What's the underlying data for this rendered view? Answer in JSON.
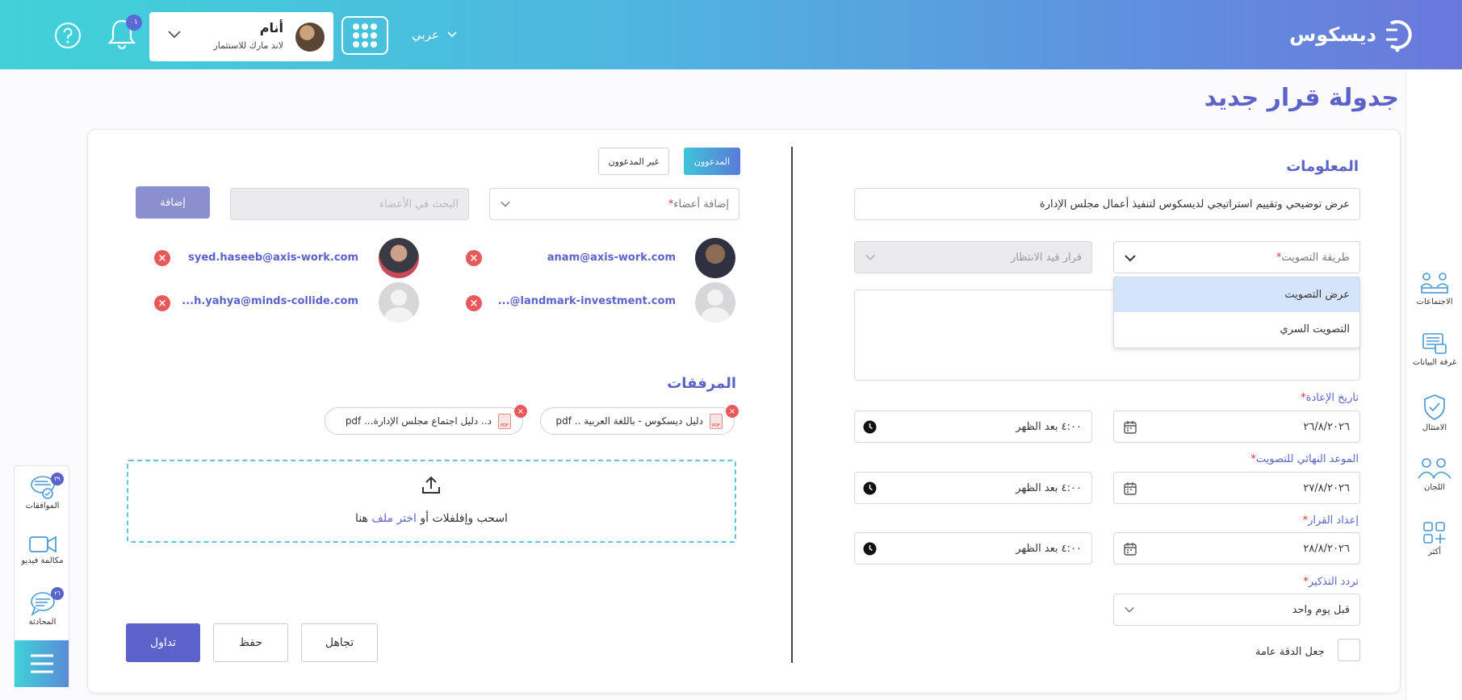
{
  "header": {
    "brand": "ديسكوس",
    "language": "عربي",
    "user_name": "أنام",
    "user_company": "لاند مارك للاستثمار",
    "notification_count": "٠١"
  },
  "page": {
    "title": "جدولة قرار جديد"
  },
  "info": {
    "section_title": "المعلومات",
    "subject_value": "عرض توضيحي وتقييم استراتيجي لديسكوس لتنفيذ أعمال مجلس الإدارة",
    "vote_method_placeholder": "طريقة التصويت",
    "status_value": "قرار قيد الانتظار",
    "vote_method_options": [
      "عرض التصويت",
      "التصويت السري"
    ],
    "reminder_date_label": "تاريخ الإعادة",
    "reminder_date": "٢٦/٨/٢٠٢٦",
    "reminder_time": "٤:٠٠ بعد الظهر",
    "deadline_label": "الموعد النهائي للتصويت",
    "deadline_date": "٢٧/٨/٢٠٢٦",
    "deadline_time": "٤:٠٠ بعد الظهر",
    "prep_label": "إعداد القرار",
    "prep_date": "٢٨/٨/٢٠٢٦",
    "prep_time": "٤:٠٠ بعد الظهر",
    "frequency_label": "تردد التذكير",
    "frequency_value": "قبل يوم واحد",
    "public_label": "جعل الدقة عامة"
  },
  "members": {
    "tab_invited": "المدعوون",
    "tab_not_invited": "غير المدعوون",
    "add_placeholder": "إضافة أعضاء",
    "search_placeholder": "البحث في الأعضاء",
    "add_button": "إضافة",
    "list": [
      {
        "email": "anam@axis-work.com"
      },
      {
        "email": "syed.haseeb@axis-work.com"
      },
      {
        "email": "...@landmark-investment.com"
      },
      {
        "email": "...h.yahya@minds-collide.com"
      }
    ]
  },
  "attachments": {
    "title": "المرفقات",
    "files": [
      {
        "name": "دليل ديسكوس - باللغة العربية .. pdf"
      },
      {
        "name": "د.. دليل اجتماع مجلس الإدارة... pdf"
      }
    ],
    "drop_text_before": "اسحب وإفلفلات أو ",
    "drop_link": "اختر ملف",
    "drop_text_after": " هنا"
  },
  "actions": {
    "circulate": "تداول",
    "save": "حفظ",
    "ignore": "تجاهل"
  },
  "right_rail": [
    {
      "label": "الاجتماعات",
      "icon": "meetings-icon"
    },
    {
      "label": "غرفة البيانات",
      "icon": "data-room-icon"
    },
    {
      "label": "الامتثال",
      "icon": "compliance-shield-icon"
    },
    {
      "label": "اللجان",
      "icon": "committees-icon"
    },
    {
      "label": "أكثر",
      "icon": "more-grid-icon"
    }
  ],
  "left_dock": [
    {
      "label": "الموافقات",
      "badge": "٣٩"
    },
    {
      "label": "مكالمة فيديو"
    },
    {
      "label": "المحادثة",
      "badge": "٢٦"
    }
  ],
  "colors": {
    "accent": "#5b63c8",
    "brand_start": "#40d2d8",
    "brand_end": "#6a78dc",
    "danger": "#e85a5a"
  }
}
